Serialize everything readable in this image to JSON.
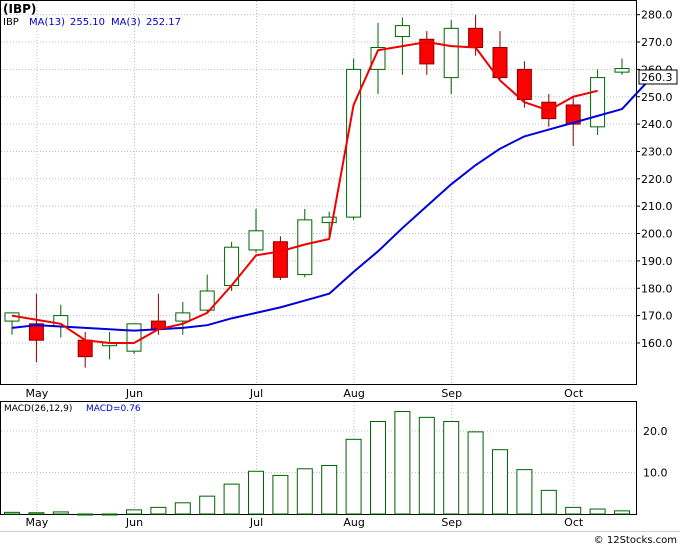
{
  "header": {
    "symbol_title": "(IBP)",
    "legend": [
      {
        "label": "IBP",
        "color": "#000000"
      },
      {
        "label": "MA(13)",
        "value": "255.10",
        "color": "#0000cc"
      },
      {
        "label": "MA(3)",
        "value": "252.17",
        "color": "#0000cc"
      }
    ],
    "last_price": "260.3",
    "macd_label": "MACD(26,12,9)",
    "macd_value_label": "MACD=0.76",
    "footer": "© 12Stocks.com"
  },
  "colors": {
    "up_fill": "#ffffff",
    "up_stroke": "#006400",
    "down_fill": "#ff0000",
    "down_stroke": "#8b0000",
    "ma13": "#0000dd",
    "ma3": "#ee0000",
    "macd_bar": "#006400",
    "grid": "#c0c0c0"
  },
  "chart_data": [
    {
      "type": "candlestick",
      "title": "(IBP)",
      "ylim": [
        145,
        285
      ],
      "y_ticks": [
        160,
        170,
        180,
        190,
        200,
        210,
        220,
        230,
        240,
        250,
        260,
        270,
        280
      ],
      "x_tick_labels": [
        {
          "label": "May",
          "index": 1
        },
        {
          "label": "Jun",
          "index": 5
        },
        {
          "label": "Jul",
          "index": 10
        },
        {
          "label": "Aug",
          "index": 14
        },
        {
          "label": "Sep",
          "index": 18
        },
        {
          "label": "Oct",
          "index": 23
        }
      ],
      "candles": [
        {
          "open": 168,
          "high": 171,
          "low": 163,
          "close": 171
        },
        {
          "open": 167,
          "high": 178,
          "low": 153,
          "close": 161
        },
        {
          "open": 166,
          "high": 174,
          "low": 162,
          "close": 170
        },
        {
          "open": 161,
          "high": 164,
          "low": 151,
          "close": 155
        },
        {
          "open": 159,
          "high": 164,
          "low": 154,
          "close": 160
        },
        {
          "open": 157,
          "high": 167,
          "low": 156,
          "close": 167
        },
        {
          "open": 168,
          "high": 178,
          "low": 163,
          "close": 165
        },
        {
          "open": 168,
          "high": 175,
          "low": 163,
          "close": 171
        },
        {
          "open": 172,
          "high": 185,
          "low": 171,
          "close": 179
        },
        {
          "open": 181,
          "high": 197,
          "low": 179,
          "close": 195
        },
        {
          "open": 194,
          "high": 209,
          "low": 193,
          "close": 201
        },
        {
          "open": 197,
          "high": 199,
          "low": 183,
          "close": 184
        },
        {
          "open": 185,
          "high": 209,
          "low": 184,
          "close": 205
        },
        {
          "open": 204,
          "high": 208,
          "low": 199,
          "close": 206
        },
        {
          "open": 206,
          "high": 264,
          "low": 205,
          "close": 260
        },
        {
          "open": 260,
          "high": 277,
          "low": 251,
          "close": 268
        },
        {
          "open": 272,
          "high": 279,
          "low": 258,
          "close": 276
        },
        {
          "open": 271,
          "high": 274,
          "low": 258,
          "close": 262
        },
        {
          "open": 257,
          "high": 278,
          "low": 251,
          "close": 275
        },
        {
          "open": 275,
          "high": 280,
          "low": 265,
          "close": 268
        },
        {
          "open": 268,
          "high": 274,
          "low": 256,
          "close": 257
        },
        {
          "open": 260,
          "high": 263,
          "low": 246,
          "close": 249
        },
        {
          "open": 248,
          "high": 251,
          "low": 239,
          "close": 242
        },
        {
          "open": 247,
          "high": 250,
          "low": 232,
          "close": 240
        },
        {
          "open": 239,
          "high": 260,
          "low": 236,
          "close": 257
        },
        {
          "open": 259,
          "high": 264,
          "low": 258,
          "close": 260.3
        }
      ],
      "series": [
        {
          "name": "MA(13)",
          "values": [
            165.5,
            166.5,
            166,
            165.5,
            165,
            164.5,
            165,
            165.5,
            166.5,
            169,
            171,
            173,
            175.5,
            178,
            186,
            193.5,
            202,
            210,
            218,
            225,
            231,
            235.5,
            238,
            240.5,
            243,
            245.5,
            255.1
          ]
        },
        {
          "name": "MA(3)",
          "values": [
            170,
            168.5,
            167,
            161,
            160,
            160,
            165,
            167,
            171,
            181,
            192,
            193.5,
            196,
            198,
            247,
            267,
            268.5,
            270,
            268.5,
            268,
            256,
            248,
            245,
            250,
            252.17
          ]
        }
      ]
    },
    {
      "type": "bar",
      "title": "MACD(26,12,9)",
      "ylim": [
        0,
        27
      ],
      "y_ticks": [
        10.0,
        20.0
      ],
      "x_tick_labels": [
        {
          "label": "May",
          "index": 1
        },
        {
          "label": "Jun",
          "index": 5
        },
        {
          "label": "Jul",
          "index": 10
        },
        {
          "label": "Aug",
          "index": 14
        },
        {
          "label": "Sep",
          "index": 18
        },
        {
          "label": "Oct",
          "index": 23
        }
      ],
      "values": [
        0.4,
        0.3,
        0.5,
        0.0,
        0.0,
        1.0,
        1.6,
        2.7,
        4.3,
        7.2,
        10.3,
        9.3,
        10.9,
        11.7,
        18.0,
        22.3,
        24.7,
        23.3,
        22.3,
        19.8,
        15.5,
        10.7,
        5.7,
        1.6,
        1.2,
        0.76
      ]
    }
  ]
}
